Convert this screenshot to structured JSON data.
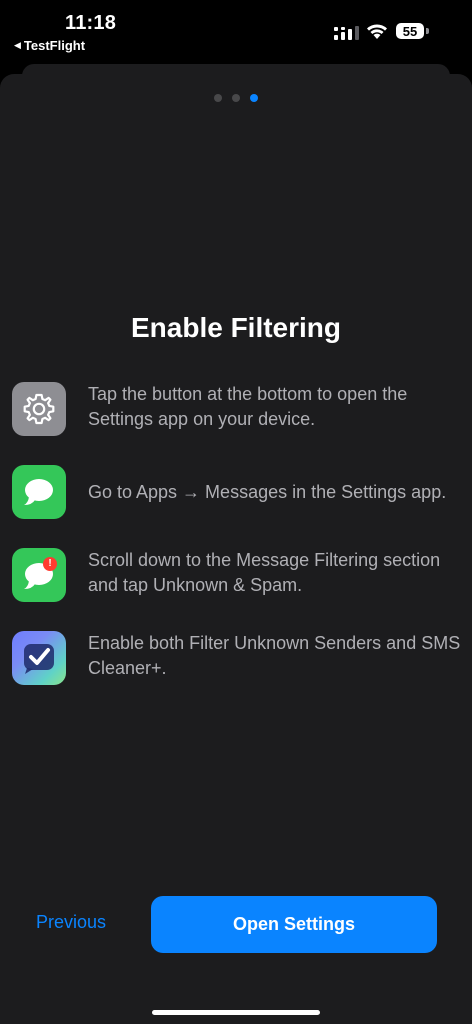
{
  "status_bar": {
    "time": "11:18",
    "back_app": "TestFlight",
    "battery": "55"
  },
  "pager": {
    "count": 3,
    "active_index": 2
  },
  "title": "Enable Filtering",
  "steps": [
    {
      "icon": "settings-gear-icon",
      "text": "Tap the button at the bottom to open the Settings app on your device."
    },
    {
      "icon": "messages-icon",
      "text": "Go to Apps → Messages in the Settings app."
    },
    {
      "icon": "messages-badge-icon",
      "text": "Scroll down to the Message Filtering section and tap Unknown & Spam.",
      "badge": "!"
    },
    {
      "icon": "sms-cleaner-icon",
      "text": "Enable both Filter Unknown Senders and SMS Cleaner+."
    }
  ],
  "buttons": {
    "previous": "Previous",
    "open_settings": "Open Settings"
  },
  "colors": {
    "accent": "#0a84ff",
    "background": "#1c1c1e",
    "messages_green": "#34c759",
    "settings_gray": "#8e8e93"
  }
}
